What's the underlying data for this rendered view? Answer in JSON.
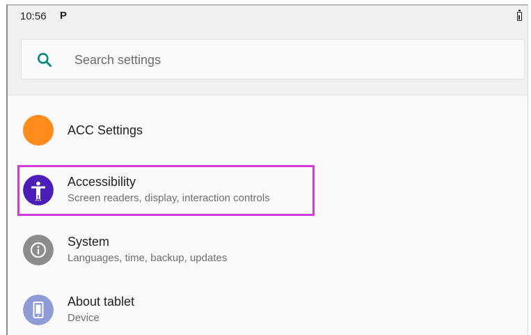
{
  "status_bar": {
    "time": "10:56",
    "notification_icon": "P"
  },
  "search": {
    "placeholder": "Search settings",
    "icon": "search-icon",
    "accent_color": "#00897b"
  },
  "settings_list": [
    {
      "title": "ACC Settings",
      "subtitle": "",
      "icon": "orange-circle-icon",
      "icon_color": "#ff8c1a"
    },
    {
      "title": "Accessibility",
      "subtitle": "Screen readers, display, interaction controls",
      "icon": "accessibility-icon",
      "icon_color": "#4a1fb8",
      "highlighted": true,
      "highlight_color": "#d63ad8"
    },
    {
      "title": "System",
      "subtitle": "Languages, time, backup, updates",
      "icon": "info-icon",
      "icon_color": "#8c8c8c"
    },
    {
      "title": "About tablet",
      "subtitle": "Device",
      "icon": "tablet-icon",
      "icon_color": "#8f9bd6"
    }
  ]
}
